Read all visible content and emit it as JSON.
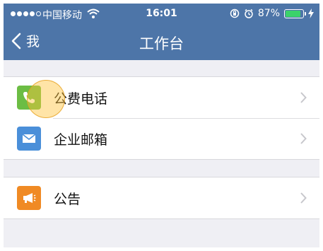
{
  "status_bar": {
    "carrier": "中国移动",
    "time": "16:01",
    "battery_percent": "87%",
    "battery_level": 0.87
  },
  "nav": {
    "back_label": "我",
    "title": "工作台"
  },
  "groups": [
    {
      "items": [
        {
          "label": "公费电话",
          "icon": "phone-icon",
          "icon_color": "#6cbd44"
        },
        {
          "label": "企业邮箱",
          "icon": "mail-icon",
          "icon_color": "#4a8fd9"
        }
      ]
    },
    {
      "items": [
        {
          "label": "公告",
          "icon": "megaphone-icon",
          "icon_color": "#f08a24"
        }
      ]
    }
  ],
  "colors": {
    "nav_background": "#4d75a8",
    "page_background": "#efeff4"
  }
}
